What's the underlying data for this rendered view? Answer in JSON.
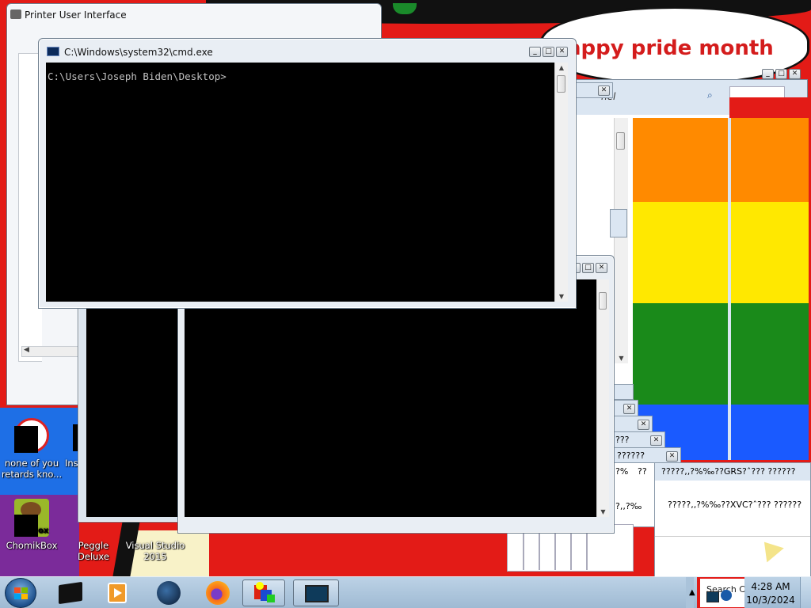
{
  "wallpaper": {
    "banner_text": "appy pride month"
  },
  "desktop_icons": [
    {
      "label": "none of you retards kno..."
    },
    {
      "label": "Ins"
    },
    {
      "label": "ChomikBox"
    },
    {
      "label": "Peggle Deluxe"
    },
    {
      "label": "Visual Studio 2015"
    }
  ],
  "printer_window": {
    "title": "Printer User Interface"
  },
  "cmd_window": {
    "title": "C:\\Windows\\system32\\cmd.exe",
    "prompt": "C:\\Users\\Joseph Biden\\Desktop>"
  },
  "control_panel_window": {
    "search_placeholder": "nel"
  },
  "error_dialogs": {
    "title_a": "???",
    "title_b": "??????",
    "title_c": "?????,,?%‰??GRS?ˆ??? ??????",
    "left_a": "?%",
    "left_b": "??",
    "left_c": "?,,?‰",
    "message": "?????,,?%‰??XVC?ˆ??? ??????"
  },
  "taskbar": {
    "search_label": "Search C",
    "clock_time": "4:28 AM",
    "clock_date": "10/3/2024"
  },
  "colors": {
    "rainbow": [
      "#ff8a00",
      "#ffe800",
      "#1a8a1a",
      "#1a5aff"
    ],
    "wallpaper_red": "#e31b17"
  },
  "icons": {
    "start": "windows-orb-icon",
    "taskbar": [
      "black-box-app-icon",
      "media-player-icon",
      "globe-app-icon",
      "firefox-icon",
      "shapes-app-icon",
      "monitor-app-icon"
    ]
  }
}
